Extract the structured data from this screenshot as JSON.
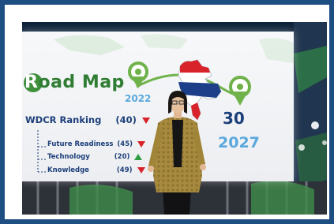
{
  "slide": {
    "title": "Road Map",
    "title_rest": "oad Map",
    "title_initial": "R",
    "ranking_label": "WDCR Ranking",
    "ranking_value": "(40)",
    "sub_items": [
      {
        "label": "Future Readiness",
        "value": "(45)",
        "trend": "down"
      },
      {
        "label": "Technology",
        "value": "(20)",
        "trend": "up"
      },
      {
        "label": "Knowledge",
        "value": "(49)",
        "trend": "down"
      }
    ],
    "year_start": "2022",
    "target_value": "30",
    "year_end": "2027"
  },
  "colors": {
    "road_green": "#2f7d33",
    "navy": "#1d3f7a",
    "down_red": "#d8232a",
    "up_green": "#2e9e44",
    "year_blue": "#5aa8dd"
  }
}
